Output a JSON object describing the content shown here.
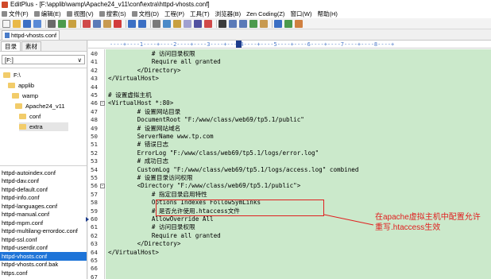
{
  "window": {
    "title": "EditPlus - [F:\\applib\\wamp\\Apache24_v11\\conf\\extra\\httpd-vhosts.conf]"
  },
  "menu": [
    "文件(F)",
    "编辑(E)",
    "视图(V)",
    "搜索(S)",
    "文档(D)",
    "工程(P)",
    "工具(T)",
    "浏览器(B)",
    "Zen Coding(Z)",
    "窗口(W)",
    "帮助(H)"
  ],
  "document_tab": "httpd-vhosts.conf",
  "left_panel": {
    "tabs": [
      "目录",
      "素材"
    ],
    "drive": "[F:]",
    "tree": [
      {
        "label": "F:\\",
        "depth": 0
      },
      {
        "label": "applib",
        "depth": 1
      },
      {
        "label": "wamp",
        "depth": 2
      },
      {
        "label": "Apache24_v11",
        "depth": 3
      },
      {
        "label": "conf",
        "depth": 4
      },
      {
        "label": "extra",
        "depth": 5,
        "selected": true
      }
    ],
    "files": [
      "httpd-autoindex.conf",
      "httpd-dav.conf",
      "httpd-default.conf",
      "httpd-info.conf",
      "httpd-languages.conf",
      "httpd-manual.conf",
      "httpd-mpm.conf",
      "httpd-multilang-errordoc.conf",
      "httpd-ssl.conf",
      "httpd-userdir.conf",
      "httpd-vhosts.conf",
      "httpd-vhosts.conf.bak",
      "https.conf"
    ],
    "selected_file": "httpd-vhosts.conf"
  },
  "ruler": "----+----1----+----2----+----3----+----4----+----5----+----6----+----7----+----8----+",
  "code": [
    {
      "n": "40",
      "t": "            # 访问目录权限"
    },
    {
      "n": "41",
      "t": "            Require all granted"
    },
    {
      "n": "42",
      "t": "        </Directory>"
    },
    {
      "n": "43",
      "t": "</VirtualHost>"
    },
    {
      "n": "44",
      "t": ""
    },
    {
      "n": "45",
      "t": "# 设置虚拟主机"
    },
    {
      "n": "46",
      "t": "<VirtualHost *:80>",
      "fold": true
    },
    {
      "n": "47",
      "t": "        # 设置网站目录"
    },
    {
      "n": "48",
      "t": "        DocumentRoot \"F:/www/class/web69/tp5.1/public\""
    },
    {
      "n": "49",
      "t": "        # 设置网站域名"
    },
    {
      "n": "50",
      "t": "        ServerName www.tp.com"
    },
    {
      "n": "51",
      "t": "        # 错误日志"
    },
    {
      "n": "52",
      "t": "        ErrorLog \"F:/www/class/web69/tp5.1/logs/error.log\""
    },
    {
      "n": "53",
      "t": "        # 成功日志"
    },
    {
      "n": "54",
      "t": "        CustomLog \"F:/www/class/web69/tp5.1/logs/access.log\" combined"
    },
    {
      "n": "55",
      "t": "        # 设置目录访问权限"
    },
    {
      "n": "56",
      "t": "        <Directory \"F:/www/class/web69/tp5.1/public\">",
      "fold": true
    },
    {
      "n": "57",
      "t": "            # 指定目录启用特性"
    },
    {
      "n": "58",
      "t": "            Options Indexes FollowSymLinks"
    },
    {
      "n": "59",
      "t": "            # 是否允许使用.htaccess文件"
    },
    {
      "n": "60",
      "t": "            AllowOverride All",
      "current": true
    },
    {
      "n": "61",
      "t": "            # 访问目录权限"
    },
    {
      "n": "62",
      "t": "            Require all granted"
    },
    {
      "n": "63",
      "t": "        </Directory>"
    },
    {
      "n": "64",
      "t": "</VirtualHost>"
    },
    {
      "n": "65",
      "t": ""
    },
    {
      "n": "66",
      "t": ""
    },
    {
      "n": "67",
      "t": ""
    }
  ],
  "annotation": "在apache虚拟主机中配置允许重写.htaccess生效",
  "colors": {
    "code_bg": "#cbe9cb",
    "annotation": "#e02020",
    "selection": "#1e74d8"
  }
}
